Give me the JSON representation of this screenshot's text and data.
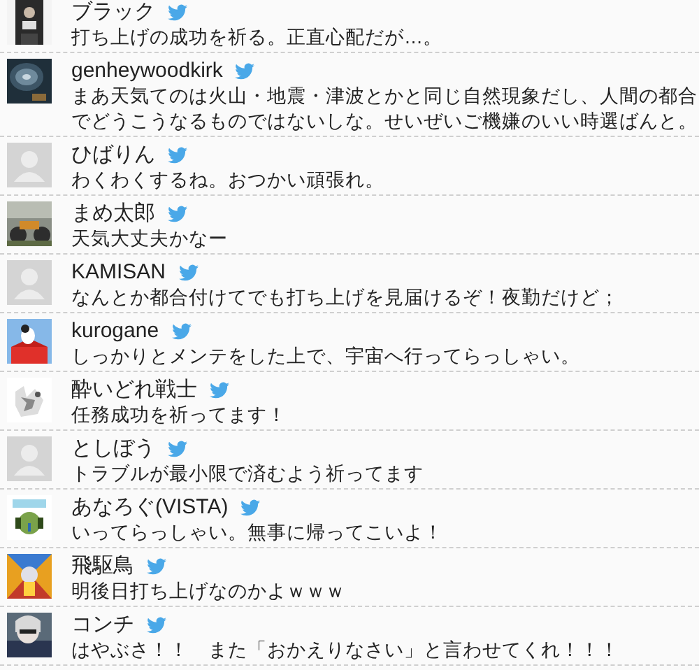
{
  "tweets": [
    {
      "name": "ブラック",
      "message": "打ち上げの成功を祈る。正直心配だが…。"
    },
    {
      "name": "genheywoodkirk",
      "message": "まあ天気てのは火山・地震・津波とかと同じ自然現象だし、人間の都合でどうこうなるものではないしな。せいぜいご機嫌のいい時選ばんと。"
    },
    {
      "name": "ひばりん",
      "message": "わくわくするね。おつかい頑張れ。",
      "avatar": {
        "kind": "placeholder"
      }
    },
    {
      "name": "まめ太郎",
      "message": "天気大丈夫かなー"
    },
    {
      "name": "KAMISAN",
      "message": "なんとか都合付けてでも打ち上げを見届けるぞ！夜勤だけど；",
      "avatar": {
        "kind": "placeholder"
      }
    },
    {
      "name": "kurogane",
      "message": "しっかりとメンテをした上で、宇宙へ行ってらっしゃい。"
    },
    {
      "name": "酔いどれ戦士",
      "message": "任務成功を祈ってます！"
    },
    {
      "name": "としぼう",
      "message": "トラブルが最小限で済むよう祈ってます",
      "avatar": {
        "kind": "placeholder"
      }
    },
    {
      "name": "あなろぐ(VISTA)",
      "message": "いってらっしゃい。無事に帰ってこいよ！"
    },
    {
      "name": "飛駆鳥",
      "message": "明後日打ち上げなのかよｗｗｗ"
    },
    {
      "name": "コンチ",
      "message": "はやぶさ！！　また「おかえりなさい」と言わせてくれ！！！"
    }
  ]
}
